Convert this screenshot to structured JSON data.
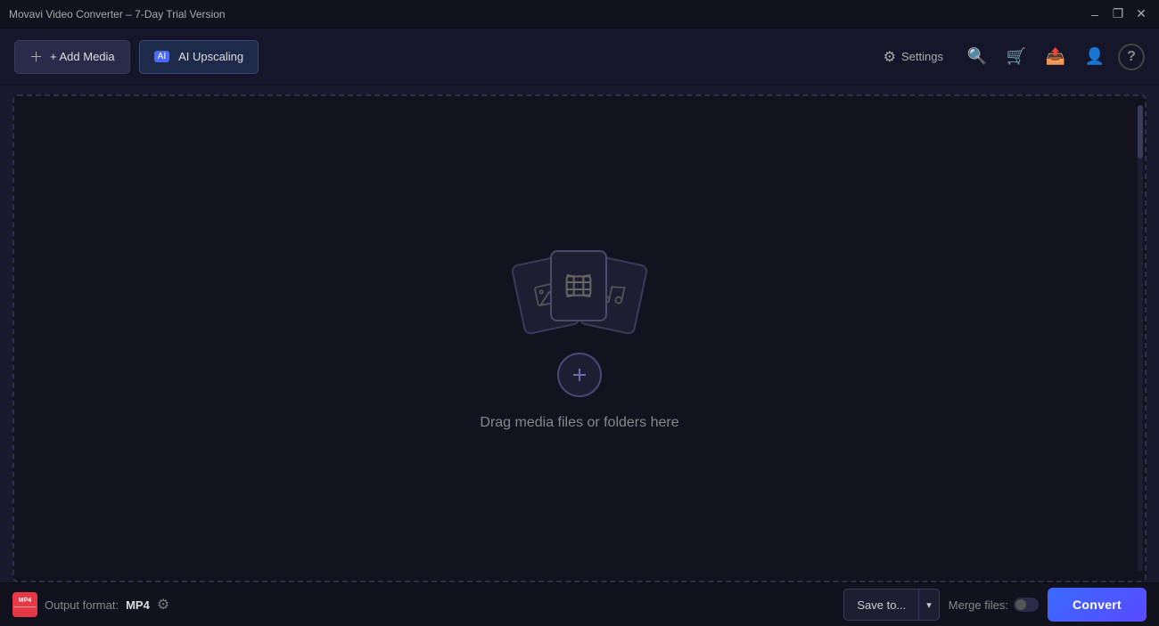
{
  "titlebar": {
    "title": "Movavi Video Converter – 7-Day Trial Version",
    "minimize": "–",
    "maximize": "❐",
    "close": "✕"
  },
  "toolbar": {
    "add_media_label": "+ Add Media",
    "ai_upscaling_label": "AI Upscaling",
    "ai_badge": "AI",
    "settings_label": "Settings",
    "search_icon": "🔍",
    "cart_icon": "🛒",
    "share_icon": "📤",
    "user_icon": "👤",
    "help_icon": "?"
  },
  "dropzone": {
    "drag_text": "Drag media files or folders here"
  },
  "bottom_bar": {
    "format_label": "MP4",
    "format_sub": "MP4",
    "output_label": "Output format:",
    "output_format": "MP4",
    "save_to_label": "Save to...",
    "merge_files_label": "Merge files:",
    "convert_label": "Convert"
  }
}
